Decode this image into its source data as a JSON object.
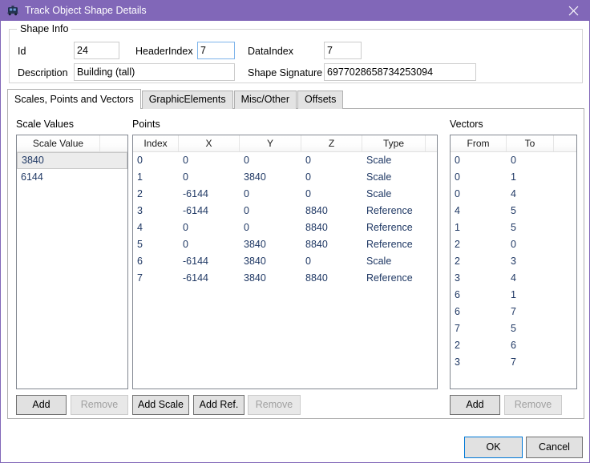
{
  "window": {
    "title": "Track Object Shape Details",
    "icon": "train-icon",
    "close_label": "✕",
    "titlebar_color": "#8167b8",
    "border_color": "#8167b8"
  },
  "shape_info": {
    "legend": "Shape Info",
    "id_label": "Id",
    "id_value": "24",
    "header_index_label": "HeaderIndex",
    "header_index_value": "7",
    "data_index_label": "DataIndex",
    "data_index_value": "7",
    "description_label": "Description",
    "description_value": "Building (tall)",
    "shape_signature_label": "Shape Signature",
    "shape_signature_value": "6977028658734253094"
  },
  "tabs": [
    {
      "label": "Scales, Points and Vectors",
      "selected": true
    },
    {
      "label": "GraphicElements",
      "selected": false
    },
    {
      "label": "Misc/Other",
      "selected": false
    },
    {
      "label": "Offsets",
      "selected": false
    }
  ],
  "scale_values": {
    "section_label": "Scale Values",
    "columns": [
      "Scale Value",
      ""
    ],
    "rows": [
      {
        "value": "3840",
        "selected": true
      },
      {
        "value": "6144",
        "selected": false
      }
    ],
    "buttons": [
      {
        "label": "Add",
        "enabled": true
      },
      {
        "label": "Remove",
        "enabled": false
      }
    ]
  },
  "points": {
    "section_label": "Points",
    "columns": [
      "Index",
      "X",
      "Y",
      "Z",
      "Type",
      ""
    ],
    "rows": [
      [
        "0",
        "0",
        "0",
        "0",
        "Scale"
      ],
      [
        "1",
        "0",
        "3840",
        "0",
        "Scale"
      ],
      [
        "2",
        "-6144",
        "0",
        "0",
        "Scale"
      ],
      [
        "3",
        "-6144",
        "0",
        "8840",
        "Reference"
      ],
      [
        "4",
        "0",
        "0",
        "8840",
        "Reference"
      ],
      [
        "5",
        "0",
        "3840",
        "8840",
        "Reference"
      ],
      [
        "6",
        "-6144",
        "3840",
        "0",
        "Scale"
      ],
      [
        "7",
        "-6144",
        "3840",
        "8840",
        "Reference"
      ]
    ],
    "buttons": [
      {
        "label": "Add Scale",
        "enabled": true
      },
      {
        "label": "Add Ref.",
        "enabled": true
      },
      {
        "label": "Remove",
        "enabled": false
      }
    ]
  },
  "vectors": {
    "section_label": "Vectors",
    "columns": [
      "From",
      "To",
      ""
    ],
    "rows": [
      [
        "0",
        "0"
      ],
      [
        "0",
        "1"
      ],
      [
        "0",
        "4"
      ],
      [
        "4",
        "5"
      ],
      [
        "1",
        "5"
      ],
      [
        "2",
        "0"
      ],
      [
        "2",
        "3"
      ],
      [
        "3",
        "4"
      ],
      [
        "6",
        "1"
      ],
      [
        "6",
        "7"
      ],
      [
        "7",
        "5"
      ],
      [
        "2",
        "6"
      ],
      [
        "3",
        "7"
      ]
    ],
    "buttons": [
      {
        "label": "Add",
        "enabled": true
      },
      {
        "label": "Remove",
        "enabled": false
      }
    ]
  },
  "dialog_buttons": {
    "ok_label": "OK",
    "cancel_label": "Cancel"
  }
}
